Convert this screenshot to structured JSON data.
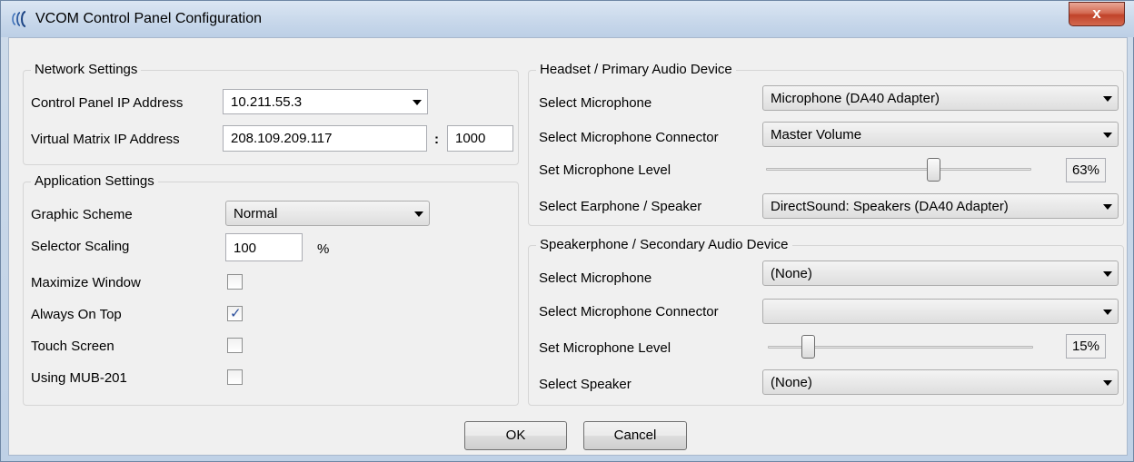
{
  "window": {
    "title": "VCOM Control Panel Configuration",
    "close_glyph": "x"
  },
  "network": {
    "title": "Network Settings",
    "cp_ip_label": "Control Panel IP Address",
    "cp_ip_value": "10.211.55.3",
    "vm_ip_label": "Virtual Matrix IP Address",
    "vm_ip_value": "208.109.209.117",
    "separator": ":",
    "port_value": "1000"
  },
  "app": {
    "title": "Application Settings",
    "scheme_label": "Graphic Scheme",
    "scheme_value": "Normal",
    "scaling_label": "Selector Scaling",
    "scaling_value": "100",
    "scaling_unit": "%",
    "maximize_label": "Maximize Window",
    "maximize_checked": false,
    "ontop_label": "Always On Top",
    "ontop_checked": true,
    "ontop_mark": "✓",
    "touch_label": "Touch Screen",
    "touch_checked": false,
    "mub_label": "Using MUB-201",
    "mub_checked": false
  },
  "headset": {
    "title": "Headset / Primary Audio Device",
    "mic_label": "Select Microphone",
    "mic_value": "Microphone (DA40 Adapter)",
    "connector_label": "Select Microphone Connector",
    "connector_value": "Master Volume",
    "level_label": "Set Microphone Level",
    "level_value": 63,
    "level_text": "63%",
    "earphone_label": "Select Earphone / Speaker",
    "earphone_value": "DirectSound: Speakers (DA40 Adapter)"
  },
  "speakerphone": {
    "title": "Speakerphone / Secondary Audio Device",
    "mic_label": "Select Microphone",
    "mic_value": "(None)",
    "connector_label": "Select Microphone Connector",
    "connector_value": "",
    "level_label": "Set Microphone Level",
    "level_value": 15,
    "level_text": "15%",
    "speaker_label": "Select Speaker",
    "speaker_value": "(None)"
  },
  "buttons": {
    "ok": "OK",
    "cancel": "Cancel"
  },
  "icons": {
    "title_icon": "vcom-sound-waves-icon",
    "close_icon": "close-icon",
    "dropdown_icon": "chevron-down-icon",
    "check_icon": "checkmark-icon"
  },
  "colors": {
    "title_bar": "#c7d7ea",
    "close_button": "#c1432a",
    "client_bg": "#f0f0f0"
  }
}
